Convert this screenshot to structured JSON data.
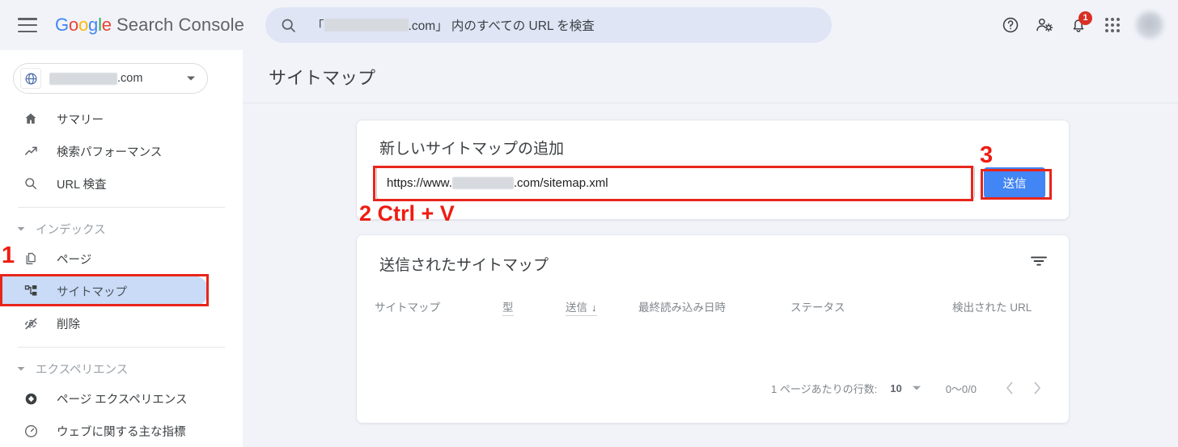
{
  "header": {
    "menu_icon": "hamburger-icon",
    "brand_google": "Google",
    "brand_product": "Search Console",
    "search": {
      "icon": "search-icon",
      "prefix": "「",
      "redacted_domain": "",
      "suffix": ".com」 内のすべての URL を検査"
    },
    "icons": [
      {
        "name": "help-icon",
        "label": "ヘルプ"
      },
      {
        "name": "account-settings-icon",
        "label": "設定"
      },
      {
        "name": "notifications-bell-icon",
        "label": "通知",
        "badge": "1"
      },
      {
        "name": "google-apps-grid-icon",
        "label": "Google アプリ"
      },
      {
        "name": "avatar",
        "label": "アカウント"
      }
    ]
  },
  "sidebar": {
    "property": {
      "icon": "globe-icon",
      "redacted_name": "",
      "suffix": ".com",
      "caret": "chevron-down-icon"
    },
    "items": [
      {
        "label": "サマリー",
        "icon": "home-icon",
        "active": false
      },
      {
        "label": "検索パフォーマンス",
        "icon": "trending-up-icon",
        "active": false
      },
      {
        "label": "URL 検査",
        "icon": "search-icon",
        "active": false
      }
    ],
    "group_index": {
      "label": "インデックス",
      "caret": "caret-down-icon",
      "items": [
        {
          "label": "ページ",
          "icon": "pages-icon",
          "active": false
        },
        {
          "label": "サイトマップ",
          "icon": "sitemap-icon",
          "active": true
        },
        {
          "label": "削除",
          "icon": "eye-off-icon",
          "active": false
        }
      ]
    },
    "group_experience": {
      "label": "エクスペリエンス",
      "caret": "caret-down-icon",
      "items": [
        {
          "label": "ページ エクスペリエンス",
          "icon": "page-experience-icon",
          "active": false
        },
        {
          "label": "ウェブに関する主な指標",
          "icon": "core-web-vitals-icon",
          "active": false
        }
      ]
    }
  },
  "main": {
    "page_title": "サイトマップ",
    "add_card": {
      "heading": "新しいサイトマップの追加",
      "input": {
        "name": "sitemap-url-input",
        "value_prefix": "https://www.",
        "redacted": "",
        "value_suffix": ".com/sitemap.xml"
      },
      "submit_label": "送信"
    },
    "list_card": {
      "heading": "送信されたサイトマップ",
      "filter_icon": "filter-icon",
      "columns": [
        {
          "label": "サイトマップ",
          "sortable": false
        },
        {
          "label": "型",
          "sortable": true
        },
        {
          "label": "送信",
          "sortable": true,
          "sort_arrow": "↓"
        },
        {
          "label": "最終読み込み日時",
          "sortable": false
        },
        {
          "label": "ステータス",
          "sortable": false
        },
        {
          "label": "検出された URL",
          "sortable": false
        }
      ],
      "rows": [],
      "pagination": {
        "rows_per_page_label": "1 ページあたりの行数:",
        "rows_per_page_value": "10",
        "caret": "chevron-down-icon",
        "range": "0〜0/0",
        "prev_icon": "chevron-left-icon",
        "next_icon": "chevron-right-icon"
      }
    }
  },
  "annotations": {
    "step1": "1",
    "step2": "2 Ctrl + V",
    "step3": "3",
    "color": "#ee1c12"
  }
}
